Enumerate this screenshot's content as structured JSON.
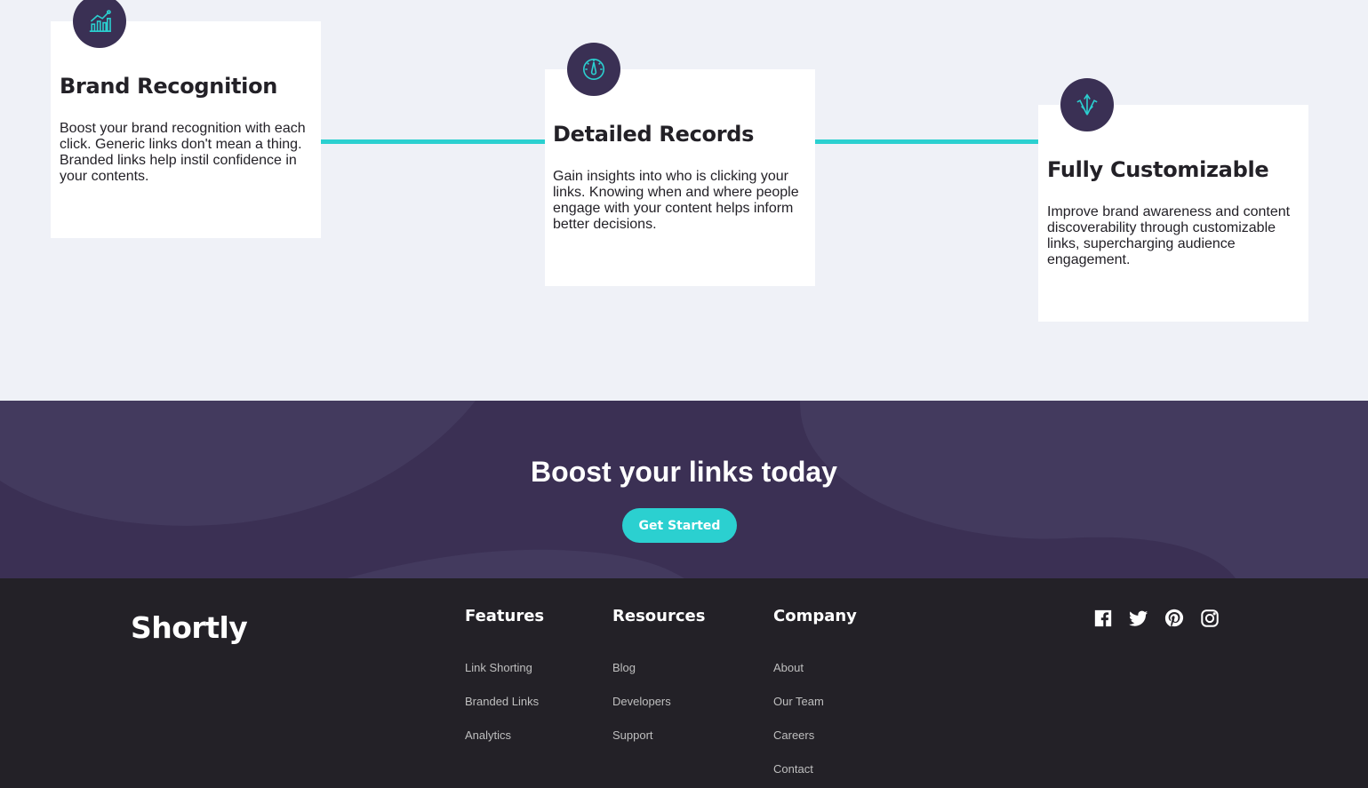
{
  "features": {
    "cards": [
      {
        "title": "Brand Recognition",
        "text": "Boost your brand recognition with each click. Generic links don't mean a thing. Branded links help instil confidence in your contents.",
        "icon": "brand-recognition-icon"
      },
      {
        "title": "Detailed Records",
        "text": "Gain insights into who is clicking your links. Knowing when and where people engage with your content helps inform better decisions.",
        "icon": "detailed-records-icon"
      },
      {
        "title": "Fully Customizable",
        "text": "Improve brand awareness and content discoverability through customizable links, supercharging audience engagement.",
        "icon": "fully-customizable-icon"
      }
    ]
  },
  "cta": {
    "title": "Boost your links today",
    "button_label": "Get Started"
  },
  "footer": {
    "logo": "Shortly",
    "columns": [
      {
        "title": "Features",
        "links": [
          "Link Shorting",
          "Branded Links",
          "Analytics"
        ]
      },
      {
        "title": "Resources",
        "links": [
          "Blog",
          "Developers",
          "Support"
        ]
      },
      {
        "title": "Company",
        "links": [
          "About",
          "Our Team",
          "Careers",
          "Contact"
        ]
      }
    ],
    "socials": [
      "facebook-icon",
      "twitter-icon",
      "pinterest-icon",
      "instagram-icon"
    ]
  },
  "colors": {
    "cyan": "#2bd0d0",
    "dark_violet": "#3b3054",
    "very_dark_violet": "#232127",
    "page_background": "#eff1f7",
    "gray": "#bfbfbf"
  }
}
